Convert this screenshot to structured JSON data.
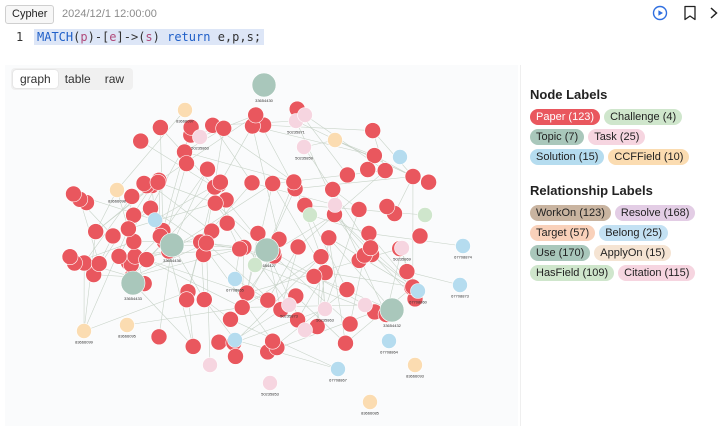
{
  "toolbar": {
    "language": "Cypher",
    "timestamp": "2024/12/1 12:00:00"
  },
  "editor": {
    "line_number": "1",
    "query_tokens": [
      {
        "t": "MATCH",
        "c": "kw"
      },
      {
        "t": "(",
        "c": ""
      },
      {
        "t": "p",
        "c": "var"
      },
      {
        "t": ")-[",
        "c": ""
      },
      {
        "t": "e",
        "c": "var"
      },
      {
        "t": "]->(",
        "c": ""
      },
      {
        "t": "s",
        "c": "var"
      },
      {
        "t": ") ",
        "c": ""
      },
      {
        "t": "return",
        "c": "kw"
      },
      {
        "t": " e,p,s;",
        "c": ""
      }
    ]
  },
  "view_tabs": [
    {
      "label": "graph",
      "active": true
    },
    {
      "label": "table",
      "active": false
    },
    {
      "label": "raw",
      "active": false
    }
  ],
  "node_labels": {
    "title": "Node Labels",
    "items": [
      {
        "label": "Paper (123)",
        "color": "#e9575e",
        "text_color": "#ffffff"
      },
      {
        "label": "Challenge (4)",
        "color": "#cfe6cc",
        "text_color": "#222222"
      },
      {
        "label": "Topic (7)",
        "color": "#a9c7bb",
        "text_color": "#222222"
      },
      {
        "label": "Task (25)",
        "color": "#f6d5e0",
        "text_color": "#222222"
      },
      {
        "label": "Solution (15)",
        "color": "#b5dcef",
        "text_color": "#222222"
      },
      {
        "label": "CCFField (10)",
        "color": "#fbdcb1",
        "text_color": "#222222"
      }
    ]
  },
  "relationship_labels": {
    "title": "Relationship Labels",
    "items": [
      {
        "label": "WorkOn (123)",
        "color": "#c9b4a0"
      },
      {
        "label": "Resolve (168)",
        "color": "#e3cde5"
      },
      {
        "label": "Target (57)",
        "color": "#f9d1ba"
      },
      {
        "label": "Belong (25)",
        "color": "#c3e1f3"
      },
      {
        "label": "Use (170)",
        "color": "#a9c7bb"
      },
      {
        "label": "ApplyOn (15)",
        "color": "#f5e4d3"
      },
      {
        "label": "HasField (109)",
        "color": "#cfe6cc"
      },
      {
        "label": "Citation (115)",
        "color": "#f6d5e0"
      }
    ]
  },
  "graph": {
    "node_colors": {
      "paper": "#e9575e",
      "challenge": "#cfe6cc",
      "topic": "#a9c7bb",
      "task": "#f6d5e0",
      "solution": "#b5dcef",
      "ccffield": "#fbdcb1"
    },
    "edge_color": "#c8d3c8",
    "label_color": "#333333",
    "large_node_labels": [
      {
        "type": "topic",
        "label": "33654430"
      },
      {
        "type": "topic",
        "label": "33654436"
      },
      {
        "type": "topic",
        "label": "33654433"
      },
      {
        "type": "topic",
        "label": "33654427"
      },
      {
        "type": "topic",
        "label": "33654432"
      }
    ],
    "small_node_labels": [
      {
        "type": "ccffield",
        "label": "83666097"
      },
      {
        "type": "ccffield",
        "label": "83666098"
      },
      {
        "type": "ccffield",
        "label": "83666099"
      },
      {
        "type": "ccffield",
        "label": "83666095"
      },
      {
        "type": "ccffield",
        "label": "83666093"
      },
      {
        "type": "ccffield",
        "label": "83666085"
      },
      {
        "type": "solution",
        "label": "67708874"
      },
      {
        "type": "solution",
        "label": "67708873"
      },
      {
        "type": "solution",
        "label": "67708860"
      },
      {
        "type": "solution",
        "label": "67708864"
      },
      {
        "type": "solution",
        "label": "67708865"
      },
      {
        "type": "solution",
        "label": "67708867"
      },
      {
        "type": "task",
        "label": "50235863"
      },
      {
        "type": "task",
        "label": "50235871"
      },
      {
        "type": "task",
        "label": "50235859"
      },
      {
        "type": "task",
        "label": "50235853"
      },
      {
        "type": "task",
        "label": "50235863"
      },
      {
        "type": "task",
        "label": "50235869"
      },
      {
        "type": "task",
        "label": "50235873"
      }
    ]
  }
}
